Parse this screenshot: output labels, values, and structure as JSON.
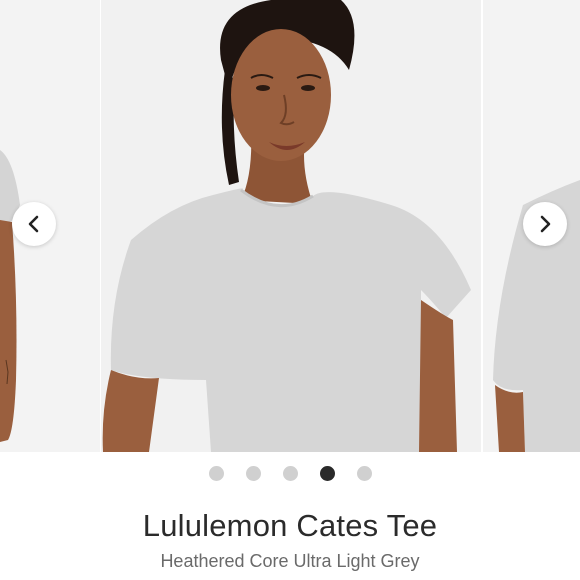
{
  "product": {
    "name": "Lululemon Cates Tee",
    "color": "Heathered Core Ultra Light Grey"
  },
  "carousel": {
    "slide_count": 5,
    "active_index": 3,
    "prev_icon": "chevron-left-icon",
    "next_icon": "chevron-right-icon"
  },
  "colors": {
    "dot_inactive": "#d0d0d0",
    "dot_active": "#2a2a2a",
    "tee": "#d6d6d6",
    "skin": "#9a5f3e"
  }
}
